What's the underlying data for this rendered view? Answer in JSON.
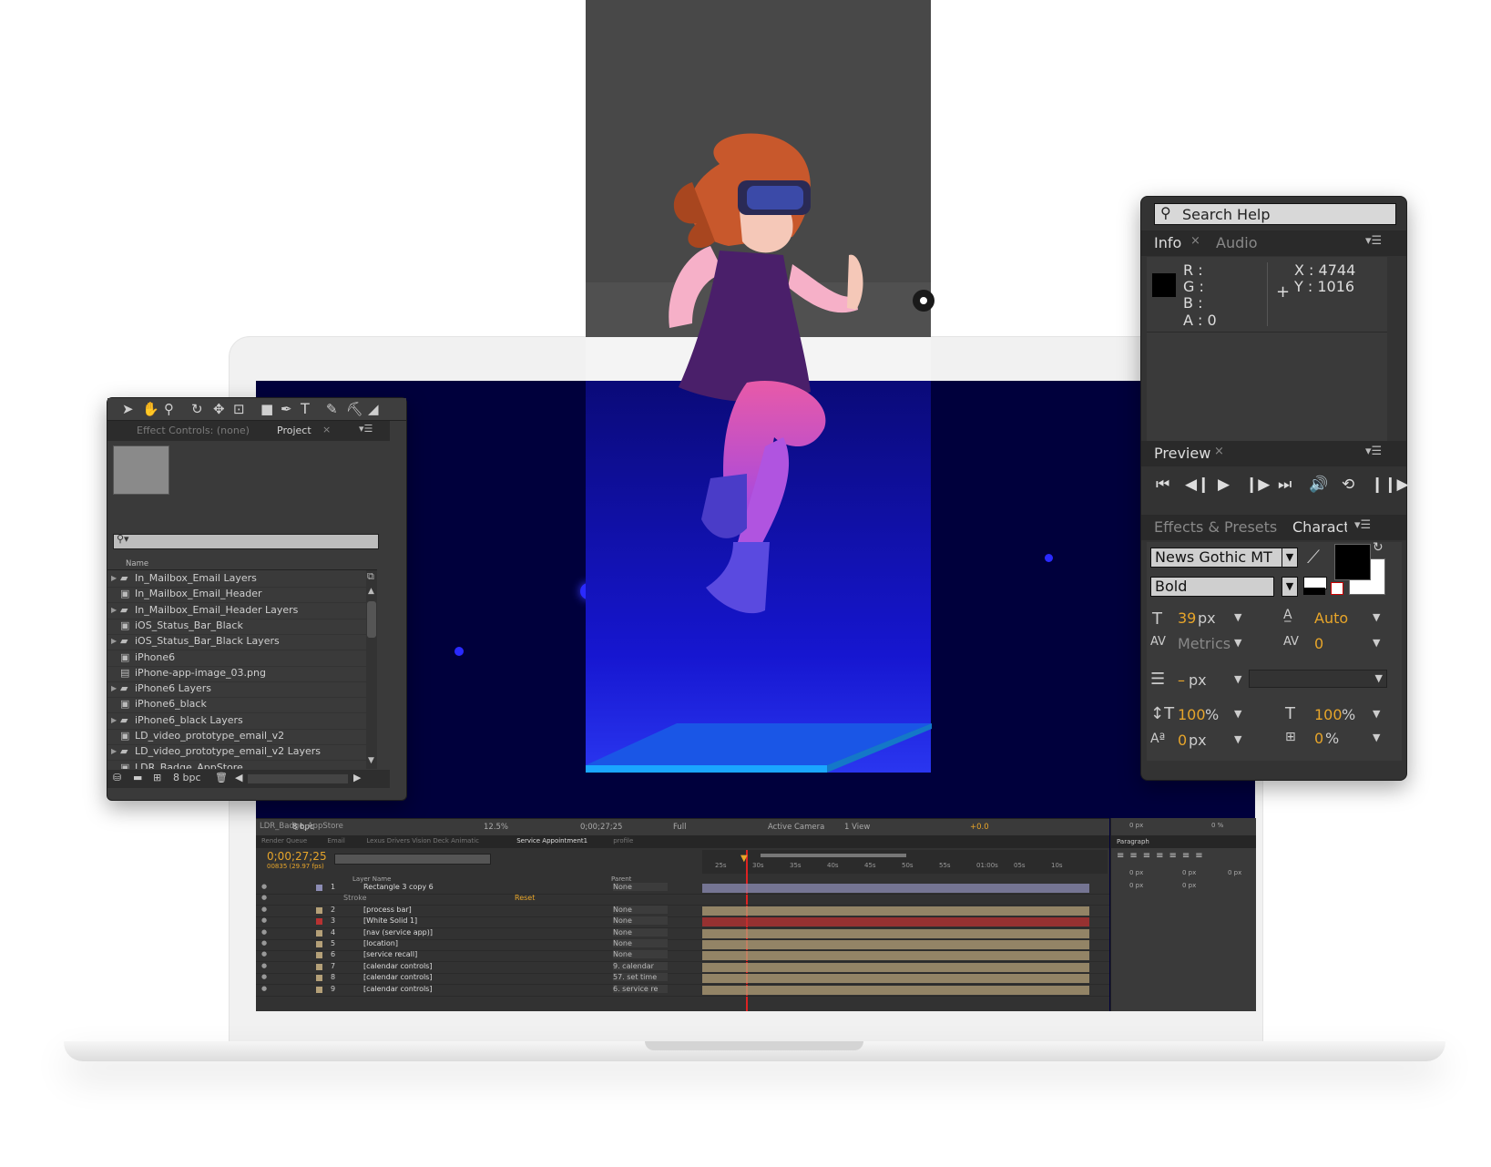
{
  "project_panel": {
    "tabs": [
      "Effect Controls: (none)",
      "Project"
    ],
    "column_name": "Name",
    "items": [
      {
        "type": "folder",
        "name": "In_Mailbox_Email Layers"
      },
      {
        "type": "comp",
        "name": "In_Mailbox_Email_Header"
      },
      {
        "type": "folder",
        "name": "In_Mailbox_Email_Header Layers"
      },
      {
        "type": "comp",
        "name": "iOS_Status_Bar_Black"
      },
      {
        "type": "folder",
        "name": "iOS_Status_Bar_Black Layers"
      },
      {
        "type": "comp",
        "name": "iPhone6"
      },
      {
        "type": "file",
        "name": "iPhone-app-image_03.png"
      },
      {
        "type": "folder",
        "name": "iPhone6 Layers"
      },
      {
        "type": "comp",
        "name": "iPhone6_black"
      },
      {
        "type": "folder",
        "name": "iPhone6_black Layers"
      },
      {
        "type": "comp",
        "name": "LD_video_prototype_email_v2"
      },
      {
        "type": "folder",
        "name": "LD_video_prototype_email_v2 Layers"
      },
      {
        "type": "comp",
        "name": "LDR_Badge_AppStore"
      }
    ],
    "bpc": "8 bpc"
  },
  "right_panel": {
    "search_placeholder": "Search Help",
    "info_tabs": [
      "Info",
      "Audio"
    ],
    "info": {
      "r": "R :",
      "g": "G :",
      "b": "B :",
      "a": "A : 0",
      "x": "X : 4744",
      "y": "Y : 1016"
    },
    "preview_tab": "Preview",
    "char_tabs": [
      "Effects & Presets",
      "Characte"
    ],
    "character": {
      "font": "News Gothic MT",
      "style": "Bold",
      "size": "39",
      "size_unit": "px",
      "leading": "Auto",
      "kerning": "Metrics",
      "tracking": "0",
      "stroke": "–",
      "stroke_unit": "px",
      "vscale": "100",
      "hscale": "100",
      "pct": "%",
      "baseline": "0",
      "baseline_unit": "px",
      "tsume": "0",
      "tsume_pct": "%"
    }
  },
  "viewer_bar": {
    "zoom": "12.5%",
    "timecode": "0;00;27;25",
    "resolution": "Full",
    "camera": "Active Camera",
    "views": "1 View",
    "exposure": "+0.0",
    "bpc": "8 bpc",
    "comp_label": "LDR_Badge_AppStore"
  },
  "timeline": {
    "tabs": [
      "Render Queue",
      "Email",
      "Lexus Drivers Vision Deck Animatic",
      "Service Appointment1",
      "profile"
    ],
    "timecode": "0;00;27;25",
    "frames": "00835 (29.97 fps)",
    "column_layer_name": "Layer Name",
    "column_parent": "Parent",
    "ruler": [
      "25s",
      "30s",
      "35s",
      "40s",
      "45s",
      "50s",
      "55s",
      "01:00s",
      "05s",
      "10s"
    ],
    "layers": [
      {
        "num": "1",
        "name": "Rectangle 3 copy 6",
        "parent": "None",
        "color": "#8c8cb4"
      },
      {
        "num": "",
        "name": "Stroke",
        "parent": "",
        "color": ""
      },
      {
        "num": "2",
        "name": "[process bar]",
        "parent": "None",
        "color": "#b4a078"
      },
      {
        "num": "3",
        "name": "[White Solid 1]",
        "parent": "None",
        "color": "#b83232"
      },
      {
        "num": "4",
        "name": "[nav (service app)]",
        "parent": "None",
        "color": "#b4a078"
      },
      {
        "num": "5",
        "name": "[location]",
        "parent": "None",
        "color": "#b4a078"
      },
      {
        "num": "6",
        "name": "[service recall]",
        "parent": "None",
        "color": "#b4a078"
      },
      {
        "num": "7",
        "name": "[calendar controls]",
        "parent": "9. calendar",
        "color": "#b4a078"
      },
      {
        "num": "8",
        "name": "[calendar controls]",
        "parent": "57. set time",
        "color": "#b4a078"
      },
      {
        "num": "9",
        "name": "[calendar controls]",
        "parent": "6. service re",
        "color": "#b4a078"
      }
    ],
    "reset": "Reset"
  },
  "side_panels": {
    "paragraph_tab": "Paragraph",
    "top_values": [
      "0 px",
      "0 %"
    ],
    "indent_values": [
      "0 px",
      "0 px",
      "0 px",
      "0 px",
      "0 px"
    ]
  },
  "colors": {
    "accent": "#e7a52a",
    "panel": "#3a3a3a",
    "screen_bg": "#00003c"
  }
}
